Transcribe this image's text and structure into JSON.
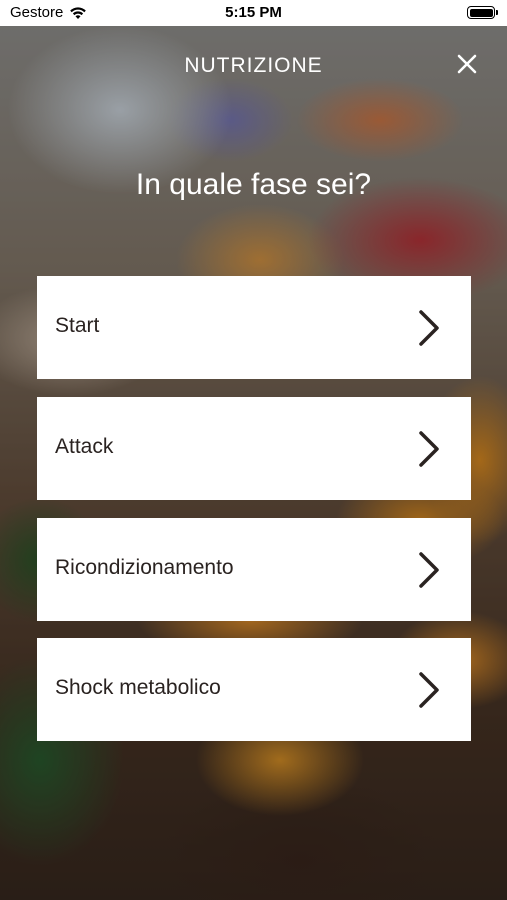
{
  "status_bar": {
    "carrier": "Gestore",
    "time": "5:15 PM",
    "icons": [
      "wifi-icon",
      "battery-icon"
    ]
  },
  "header": {
    "title": "NUTRIZIONE",
    "close_icon": "close-icon"
  },
  "question": "In quale fase sei?",
  "options": [
    {
      "label": "Start",
      "icon": "chevron-right-icon"
    },
    {
      "label": "Attack",
      "icon": "chevron-right-icon"
    },
    {
      "label": "Ricondizionamento",
      "icon": "chevron-right-icon"
    },
    {
      "label": "Shock metabolico",
      "icon": "chevron-right-icon"
    }
  ],
  "colors": {
    "card_background": "#ffffff",
    "card_text": "#2a2321",
    "header_text": "#ffffff"
  }
}
